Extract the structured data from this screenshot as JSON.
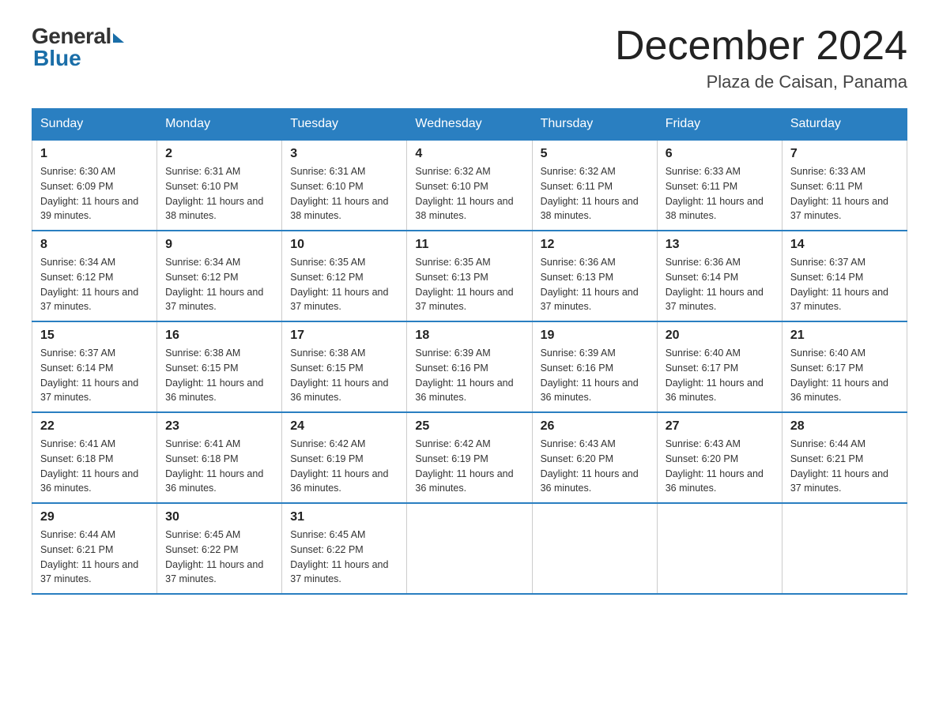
{
  "logo": {
    "general": "General",
    "blue": "Blue"
  },
  "title": "December 2024",
  "location": "Plaza de Caisan, Panama",
  "days_header": [
    "Sunday",
    "Monday",
    "Tuesday",
    "Wednesday",
    "Thursday",
    "Friday",
    "Saturday"
  ],
  "weeks": [
    [
      {
        "day": "1",
        "sunrise": "6:30 AM",
        "sunset": "6:09 PM",
        "daylight": "11 hours and 39 minutes."
      },
      {
        "day": "2",
        "sunrise": "6:31 AM",
        "sunset": "6:10 PM",
        "daylight": "11 hours and 38 minutes."
      },
      {
        "day": "3",
        "sunrise": "6:31 AM",
        "sunset": "6:10 PM",
        "daylight": "11 hours and 38 minutes."
      },
      {
        "day": "4",
        "sunrise": "6:32 AM",
        "sunset": "6:10 PM",
        "daylight": "11 hours and 38 minutes."
      },
      {
        "day": "5",
        "sunrise": "6:32 AM",
        "sunset": "6:11 PM",
        "daylight": "11 hours and 38 minutes."
      },
      {
        "day": "6",
        "sunrise": "6:33 AM",
        "sunset": "6:11 PM",
        "daylight": "11 hours and 38 minutes."
      },
      {
        "day": "7",
        "sunrise": "6:33 AM",
        "sunset": "6:11 PM",
        "daylight": "11 hours and 37 minutes."
      }
    ],
    [
      {
        "day": "8",
        "sunrise": "6:34 AM",
        "sunset": "6:12 PM",
        "daylight": "11 hours and 37 minutes."
      },
      {
        "day": "9",
        "sunrise": "6:34 AM",
        "sunset": "6:12 PM",
        "daylight": "11 hours and 37 minutes."
      },
      {
        "day": "10",
        "sunrise": "6:35 AM",
        "sunset": "6:12 PM",
        "daylight": "11 hours and 37 minutes."
      },
      {
        "day": "11",
        "sunrise": "6:35 AM",
        "sunset": "6:13 PM",
        "daylight": "11 hours and 37 minutes."
      },
      {
        "day": "12",
        "sunrise": "6:36 AM",
        "sunset": "6:13 PM",
        "daylight": "11 hours and 37 minutes."
      },
      {
        "day": "13",
        "sunrise": "6:36 AM",
        "sunset": "6:14 PM",
        "daylight": "11 hours and 37 minutes."
      },
      {
        "day": "14",
        "sunrise": "6:37 AM",
        "sunset": "6:14 PM",
        "daylight": "11 hours and 37 minutes."
      }
    ],
    [
      {
        "day": "15",
        "sunrise": "6:37 AM",
        "sunset": "6:14 PM",
        "daylight": "11 hours and 37 minutes."
      },
      {
        "day": "16",
        "sunrise": "6:38 AM",
        "sunset": "6:15 PM",
        "daylight": "11 hours and 36 minutes."
      },
      {
        "day": "17",
        "sunrise": "6:38 AM",
        "sunset": "6:15 PM",
        "daylight": "11 hours and 36 minutes."
      },
      {
        "day": "18",
        "sunrise": "6:39 AM",
        "sunset": "6:16 PM",
        "daylight": "11 hours and 36 minutes."
      },
      {
        "day": "19",
        "sunrise": "6:39 AM",
        "sunset": "6:16 PM",
        "daylight": "11 hours and 36 minutes."
      },
      {
        "day": "20",
        "sunrise": "6:40 AM",
        "sunset": "6:17 PM",
        "daylight": "11 hours and 36 minutes."
      },
      {
        "day": "21",
        "sunrise": "6:40 AM",
        "sunset": "6:17 PM",
        "daylight": "11 hours and 36 minutes."
      }
    ],
    [
      {
        "day": "22",
        "sunrise": "6:41 AM",
        "sunset": "6:18 PM",
        "daylight": "11 hours and 36 minutes."
      },
      {
        "day": "23",
        "sunrise": "6:41 AM",
        "sunset": "6:18 PM",
        "daylight": "11 hours and 36 minutes."
      },
      {
        "day": "24",
        "sunrise": "6:42 AM",
        "sunset": "6:19 PM",
        "daylight": "11 hours and 36 minutes."
      },
      {
        "day": "25",
        "sunrise": "6:42 AM",
        "sunset": "6:19 PM",
        "daylight": "11 hours and 36 minutes."
      },
      {
        "day": "26",
        "sunrise": "6:43 AM",
        "sunset": "6:20 PM",
        "daylight": "11 hours and 36 minutes."
      },
      {
        "day": "27",
        "sunrise": "6:43 AM",
        "sunset": "6:20 PM",
        "daylight": "11 hours and 36 minutes."
      },
      {
        "day": "28",
        "sunrise": "6:44 AM",
        "sunset": "6:21 PM",
        "daylight": "11 hours and 37 minutes."
      }
    ],
    [
      {
        "day": "29",
        "sunrise": "6:44 AM",
        "sunset": "6:21 PM",
        "daylight": "11 hours and 37 minutes."
      },
      {
        "day": "30",
        "sunrise": "6:45 AM",
        "sunset": "6:22 PM",
        "daylight": "11 hours and 37 minutes."
      },
      {
        "day": "31",
        "sunrise": "6:45 AM",
        "sunset": "6:22 PM",
        "daylight": "11 hours and 37 minutes."
      },
      null,
      null,
      null,
      null
    ]
  ]
}
